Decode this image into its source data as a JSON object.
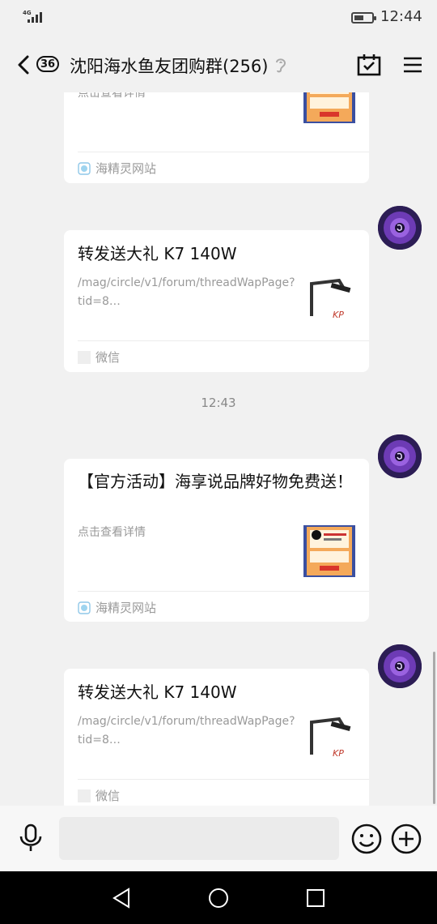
{
  "status": {
    "network": "4G",
    "signal_level": 5,
    "battery_level": 0.55,
    "time": "12:44"
  },
  "header": {
    "unread_count": "36",
    "title": "沈阳海水鱼友团购群(256)",
    "icons": [
      "back-arrow-icon",
      "ear-icon",
      "calendar-check-icon",
      "menu-icon"
    ]
  },
  "messages": [
    {
      "title": "",
      "desc": "点击查看详情",
      "source": "海精灵网站",
      "source_icon": "sea-elf-logo-icon"
    },
    {
      "title": "转发送大礼 K7 140W",
      "desc": "/mag/circle/v1/forum/threadWapPage?tid=8…",
      "source": "微信",
      "source_icon": "wechat-placeholder-icon"
    },
    {
      "title": "【官方活动】海享说品牌好物免费送！",
      "desc": "点击查看详情",
      "source": "海精灵网站",
      "source_icon": "sea-elf-logo-icon"
    },
    {
      "title": "转发送大礼 K7 140W",
      "desc": "/mag/circle/v1/forum/threadWapPage?tid=8…",
      "source": "微信",
      "source_icon": "wechat-placeholder-icon"
    }
  ],
  "time_divider": "12:43",
  "input_bar": {
    "icons": [
      "voice-icon",
      "emoji-icon",
      "plus-icon"
    ]
  },
  "nav": {
    "icons": [
      "nav-back-icon",
      "nav-home-icon",
      "nav-recent-icon"
    ]
  },
  "colors": {
    "background": "#f1f1f1",
    "card": "#ffffff",
    "muted_text": "#999999",
    "nav_bar": "#000000"
  }
}
